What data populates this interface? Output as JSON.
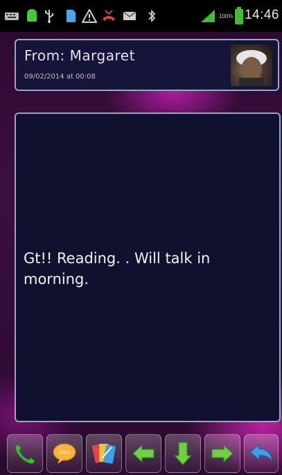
{
  "status_bar": {
    "battery_percent": "100%",
    "time": "14:46",
    "icons": [
      "keyboard-icon",
      "android-icon",
      "usb-icon",
      "sd-card-icon",
      "warning-icon",
      "missed-call-icon",
      "email-icon",
      "bluetooth-icon",
      "signal-icon",
      "battery-icon"
    ]
  },
  "header": {
    "from": "From: Margaret",
    "date": "09/02/2014 at 00:08"
  },
  "message": {
    "text": "Gt!! Reading. . Will talk in morning."
  },
  "toolbar": {
    "buttons": [
      "call-button",
      "sms-button",
      "contacts-button",
      "previous-button",
      "download-button",
      "next-button",
      "reply-button"
    ]
  },
  "colors": {
    "panel_border": "#9aa7c7",
    "panel_bg": "#10112e",
    "accent_green": "#3fbf2f",
    "accent_blue": "#3aa0e8"
  }
}
